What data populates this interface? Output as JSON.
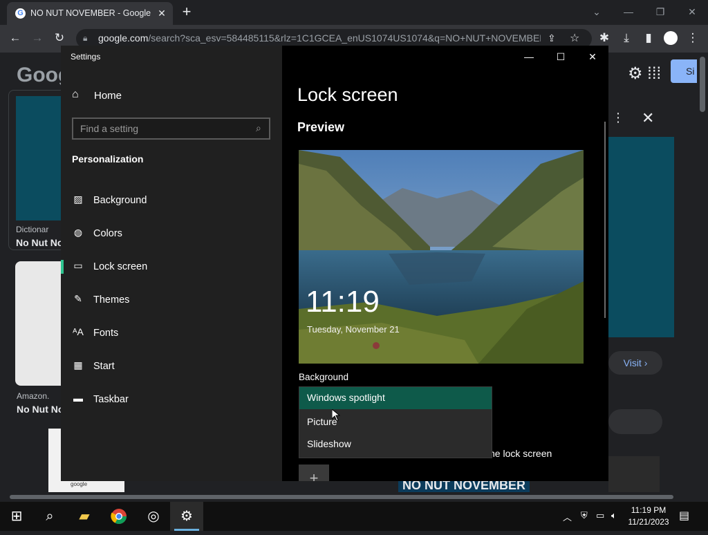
{
  "browser": {
    "tab_title": "NO NUT NOVEMBER - Google S",
    "url_domain": "google.com",
    "url_rest": "/search?sca_esv=584485115&rlz=1C1GCEA_enUS1074US1074&q=NO+NUT+NOVEMBER...",
    "new_tab": "+",
    "tab_close": "✕"
  },
  "background_page": {
    "logo": "Goog",
    "card1_source": "Dictionar",
    "card1_title": "No Nut No",
    "card2_source": "Amazon.",
    "card2_title": "No Nut No",
    "visit_label": "Visit ›",
    "signin_label": "Si",
    "banner_text": "NO NUT NOVEMBER",
    "card3_text": "google"
  },
  "settings": {
    "app_title": "Settings",
    "home_label": "Home",
    "search_placeholder": "Find a setting",
    "section_label": "Personalization",
    "nav_items": [
      {
        "label": "Background",
        "icon": "image-icon"
      },
      {
        "label": "Colors",
        "icon": "palette-icon"
      },
      {
        "label": "Lock screen",
        "icon": "lock-screen-icon"
      },
      {
        "label": "Themes",
        "icon": "brush-icon"
      },
      {
        "label": "Fonts",
        "icon": "font-icon"
      },
      {
        "label": "Start",
        "icon": "start-icon"
      },
      {
        "label": "Taskbar",
        "icon": "taskbar-icon"
      }
    ],
    "selected_nav": "Lock screen",
    "page_title": "Lock screen",
    "preview_heading": "Preview",
    "preview_time": "11:19",
    "preview_date": "Tuesday, November 21",
    "background_label": "Background",
    "background_options": [
      "Windows spotlight",
      "Picture",
      "Slideshow"
    ],
    "selected_option": "Windows spotlight",
    "behind_text": "he lock screen",
    "add_label": "+"
  },
  "taskbar": {
    "time": "11:19 PM",
    "date": "11/21/2023",
    "accent": "#6ab0de"
  },
  "colors": {
    "settings_accent": "#2ec48f",
    "dropdown_selected": "#0e5a4a"
  }
}
